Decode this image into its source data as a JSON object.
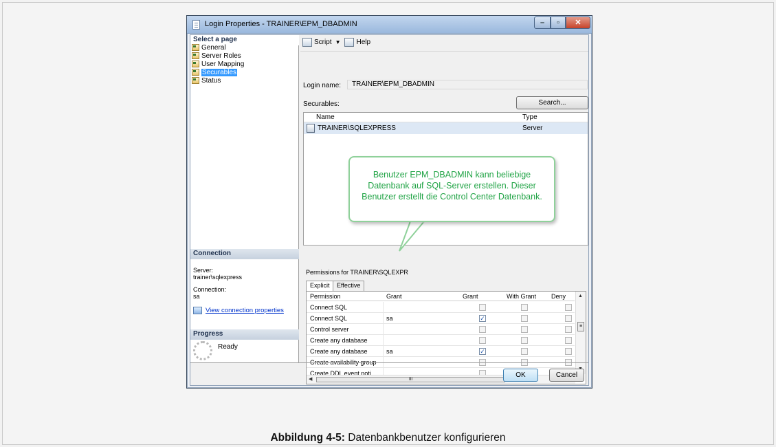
{
  "window": {
    "title": "Login Properties - TRAINER\\EPM_DBADMIN"
  },
  "left_pane": {
    "select_page_heading": "Select a page",
    "pages": [
      {
        "label": "General"
      },
      {
        "label": "Server Roles"
      },
      {
        "label": "User Mapping"
      },
      {
        "label": "Securables",
        "selected": true
      },
      {
        "label": "Status"
      }
    ],
    "connection_heading": "Connection",
    "server_label": "Server:",
    "server_value": "trainer\\sqlexpress",
    "connection_label": "Connection:",
    "connection_value": "sa",
    "view_connection_link": "View connection properties",
    "progress_heading": "Progress",
    "progress_status": "Ready"
  },
  "toolbar": {
    "script_label": "Script",
    "help_label": "Help"
  },
  "form": {
    "login_name_label": "Login name:",
    "login_name_value": "TRAINER\\EPM_DBADMIN",
    "securables_label": "Securables:",
    "search_button": "Search..."
  },
  "securables_grid": {
    "columns": [
      "Name",
      "Type"
    ],
    "rows": [
      {
        "name": "TRAINER\\SQLEXPRESS",
        "type": "Server"
      }
    ]
  },
  "callout": {
    "text": "Benutzer EPM_DBADMIN kann beliebige Datenbank auf SQL-Server erstellen. Dieser Benutzer erstellt die Control Center Datenbank."
  },
  "permissions": {
    "label": "Permissions for TRAINER\\SQLEXPR",
    "tabs": [
      "Explicit",
      "Effective"
    ],
    "columns": [
      "Permission",
      "Grant",
      "Grant",
      "With Grant",
      "Deny"
    ],
    "rows": [
      {
        "permission": "Connect SQL",
        "grantor": "",
        "grant": false,
        "with_grant": false,
        "deny": false
      },
      {
        "permission": "Connect SQL",
        "grantor": "sa",
        "grant": true,
        "with_grant": false,
        "deny": false
      },
      {
        "permission": "Control server",
        "grantor": "",
        "grant": false,
        "with_grant": false,
        "deny": false
      },
      {
        "permission": "Create any database",
        "grantor": "",
        "grant": false,
        "with_grant": false,
        "deny": false
      },
      {
        "permission": "Create any database",
        "grantor": "sa",
        "grant": true,
        "with_grant": false,
        "deny": false
      },
      {
        "permission": "Create availability group",
        "grantor": "",
        "grant": false,
        "with_grant": false,
        "deny": false
      },
      {
        "permission": "Create DDL event noti",
        "grantor": "",
        "grant": false,
        "with_grant": false,
        "deny": false
      }
    ]
  },
  "buttons": {
    "ok": "OK",
    "cancel": "Cancel"
  },
  "caption": {
    "prefix": "Abbildung 4-5:",
    "text": "Datenbankbenutzer konfigurieren"
  }
}
